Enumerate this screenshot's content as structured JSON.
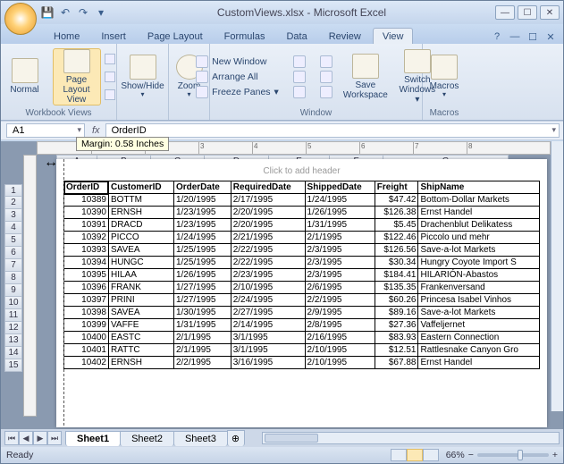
{
  "title": "CustomViews.xlsx - Microsoft Excel",
  "tabs": [
    "Home",
    "Insert",
    "Page Layout",
    "Formulas",
    "Data",
    "Review",
    "View"
  ],
  "active_tab": "View",
  "ribbon": {
    "views_group": "Workbook Views",
    "normal": "Normal",
    "page_layout": "Page Layout View",
    "showhide": "Show/Hide",
    "zoom": "Zoom",
    "window_group": "Window",
    "new_window": "New Window",
    "arrange_all": "Arrange All",
    "freeze": "Freeze Panes",
    "save_ws": "Save Workspace",
    "switch": "Switch Windows",
    "macros_group": "Macros",
    "macros": "Macros"
  },
  "namebox": "A1",
  "formula": "OrderID",
  "tooltip": "Margin: 0.58 Inches",
  "page_header": "Click to add header",
  "cols": [
    "A",
    "B",
    "C",
    "D",
    "E",
    "F",
    "G"
  ],
  "headers": [
    "OrderID",
    "CustomerID",
    "OrderDate",
    "RequiredDate",
    "ShippedDate",
    "Freight",
    "ShipName"
  ],
  "rows": [
    [
      "10389",
      "BOTTM",
      "1/20/1995",
      "2/17/1995",
      "1/24/1995",
      "$47.42",
      "Bottom-Dollar Markets"
    ],
    [
      "10390",
      "ERNSH",
      "1/23/1995",
      "2/20/1995",
      "1/26/1995",
      "$126.38",
      "Ernst Handel"
    ],
    [
      "10391",
      "DRACD",
      "1/23/1995",
      "2/20/1995",
      "1/31/1995",
      "$5.45",
      "Drachenblut Delikatess"
    ],
    [
      "10392",
      "PICCO",
      "1/24/1995",
      "2/21/1995",
      "2/1/1995",
      "$122.46",
      "Piccolo und mehr"
    ],
    [
      "10393",
      "SAVEA",
      "1/25/1995",
      "2/22/1995",
      "2/3/1995",
      "$126.56",
      "Save-a-lot Markets"
    ],
    [
      "10394",
      "HUNGC",
      "1/25/1995",
      "2/22/1995",
      "2/3/1995",
      "$30.34",
      "Hungry Coyote Import S"
    ],
    [
      "10395",
      "HILAA",
      "1/26/1995",
      "2/23/1995",
      "2/3/1995",
      "$184.41",
      "HILARIÓN-Abastos"
    ],
    [
      "10396",
      "FRANK",
      "1/27/1995",
      "2/10/1995",
      "2/6/1995",
      "$135.35",
      "Frankenversand"
    ],
    [
      "10397",
      "PRINI",
      "1/27/1995",
      "2/24/1995",
      "2/2/1995",
      "$60.26",
      "Princesa Isabel Vinhos"
    ],
    [
      "10398",
      "SAVEA",
      "1/30/1995",
      "2/27/1995",
      "2/9/1995",
      "$89.16",
      "Save-a-lot Markets"
    ],
    [
      "10399",
      "VAFFE",
      "1/31/1995",
      "2/14/1995",
      "2/8/1995",
      "$27.36",
      "Vaffeljernet"
    ],
    [
      "10400",
      "EASTC",
      "2/1/1995",
      "3/1/1995",
      "2/16/1995",
      "$83.93",
      "Eastern Connection"
    ],
    [
      "10401",
      "RATTC",
      "2/1/1995",
      "3/1/1995",
      "2/10/1995",
      "$12.51",
      "Rattlesnake Canyon Gro"
    ],
    [
      "10402",
      "ERNSH",
      "2/2/1995",
      "3/16/1995",
      "2/10/1995",
      "$67.88",
      "Ernst Handel"
    ]
  ],
  "row_numbers": [
    "1",
    "2",
    "3",
    "4",
    "5",
    "6",
    "7",
    "8",
    "9",
    "10",
    "11",
    "12",
    "13",
    "14",
    "15"
  ],
  "sheets": [
    "Sheet1",
    "Sheet2",
    "Sheet3"
  ],
  "status": "Ready",
  "zoom": "66%"
}
